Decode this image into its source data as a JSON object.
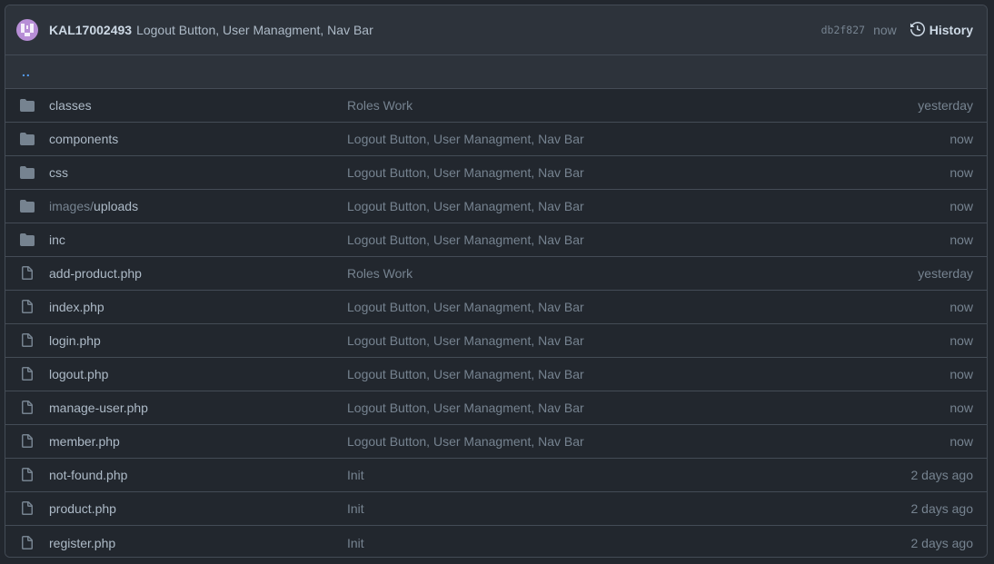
{
  "commit": {
    "author": "KAL17002493",
    "message": "Logout Button, User Managment, Nav Bar",
    "sha": "db2f827",
    "time": "now",
    "history_label": "History"
  },
  "up_link": "..",
  "colors": {
    "accent": "#539bf5",
    "background": "#22272e",
    "header_bg": "#2d333b",
    "border": "#444c56",
    "icon": "#768390"
  },
  "files": [
    {
      "type": "dir",
      "prefix": "",
      "name": "classes",
      "icon": "folder-icon",
      "commit": "Roles Work",
      "age": "yesterday"
    },
    {
      "type": "dir",
      "prefix": "",
      "name": "components",
      "icon": "folder-icon",
      "commit": "Logout Button, User Managment, Nav Bar",
      "age": "now"
    },
    {
      "type": "dir",
      "prefix": "",
      "name": "css",
      "icon": "folder-icon",
      "commit": "Logout Button, User Managment, Nav Bar",
      "age": "now"
    },
    {
      "type": "dir",
      "prefix": "images/",
      "name": "uploads",
      "icon": "folder-icon",
      "commit": "Logout Button, User Managment, Nav Bar",
      "age": "now"
    },
    {
      "type": "dir",
      "prefix": "",
      "name": "inc",
      "icon": "folder-icon",
      "commit": "Logout Button, User Managment, Nav Bar",
      "age": "now"
    },
    {
      "type": "file",
      "prefix": "",
      "name": "add-product.php",
      "icon": "file-icon",
      "commit": "Roles Work",
      "age": "yesterday"
    },
    {
      "type": "file",
      "prefix": "",
      "name": "index.php",
      "icon": "file-icon",
      "commit": "Logout Button, User Managment, Nav Bar",
      "age": "now"
    },
    {
      "type": "file",
      "prefix": "",
      "name": "login.php",
      "icon": "file-icon",
      "commit": "Logout Button, User Managment, Nav Bar",
      "age": "now"
    },
    {
      "type": "file",
      "prefix": "",
      "name": "logout.php",
      "icon": "file-icon",
      "commit": "Logout Button, User Managment, Nav Bar",
      "age": "now"
    },
    {
      "type": "file",
      "prefix": "",
      "name": "manage-user.php",
      "icon": "file-icon",
      "commit": "Logout Button, User Managment, Nav Bar",
      "age": "now"
    },
    {
      "type": "file",
      "prefix": "",
      "name": "member.php",
      "icon": "file-icon",
      "commit": "Logout Button, User Managment, Nav Bar",
      "age": "now"
    },
    {
      "type": "file",
      "prefix": "",
      "name": "not-found.php",
      "icon": "file-icon",
      "commit": "Init",
      "age": "2 days ago"
    },
    {
      "type": "file",
      "prefix": "",
      "name": "product.php",
      "icon": "file-icon",
      "commit": "Init",
      "age": "2 days ago"
    },
    {
      "type": "file",
      "prefix": "",
      "name": "register.php",
      "icon": "file-icon",
      "commit": "Init",
      "age": "2 days ago"
    }
  ]
}
